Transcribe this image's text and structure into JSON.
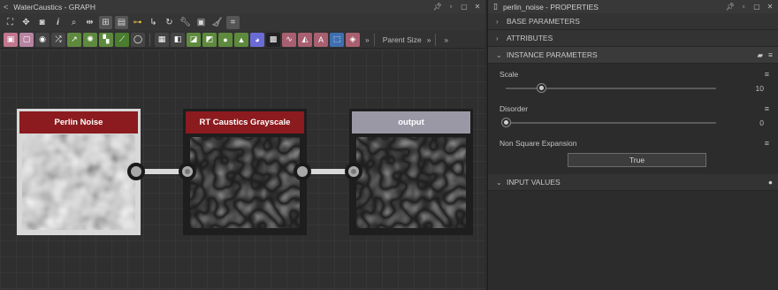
{
  "graph": {
    "window_title": "WaterCaustics - GRAPH",
    "toolbar_more": "»",
    "parent_size_label": "Parent Size",
    "parent_size_more": "»",
    "overflow_more": "»"
  },
  "nodes": [
    {
      "title": "Perlin Noise",
      "header_color": "#8c1b1f",
      "selected": true
    },
    {
      "title": "RT Caustics Grayscale",
      "header_color": "#8c1b1f",
      "selected": false
    },
    {
      "title": "output",
      "header_color": "#9b98a6",
      "selected": false
    }
  ],
  "properties": {
    "window_title": "perlin_noise - PROPERTIES",
    "sections": {
      "base": "BASE PARAMETERS",
      "attributes": "ATTRIBUTES",
      "instance": "INSTANCE PARAMETERS",
      "input": "INPUT VALUES"
    },
    "params": {
      "scale_label": "Scale",
      "scale_value": "10",
      "scale_fraction": 0.17,
      "disorder_label": "Disorder",
      "disorder_value": "0",
      "disorder_fraction": 0.0,
      "nse_label": "Non Square Expansion",
      "nse_button": "True"
    }
  },
  "colors": {
    "node_red": "#8c1b1f",
    "node_grey": "#9b98a6",
    "accent_yellow": "#e6c33a"
  }
}
